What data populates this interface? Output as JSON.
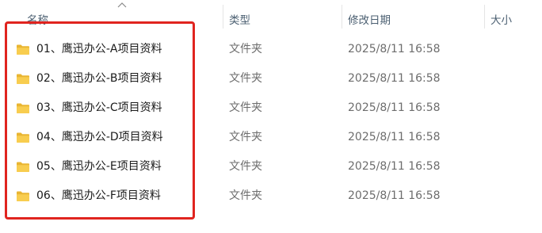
{
  "columns": {
    "name": "名称",
    "type": "类型",
    "date": "修改日期",
    "size": "大小"
  },
  "rows": [
    {
      "name": "01、鹰迅办公-A项目资料",
      "type": "文件夹",
      "date": "2025/8/11 16:58",
      "icon": "folder-icon"
    },
    {
      "name": "02、鹰迅办公-B项目资料",
      "type": "文件夹",
      "date": "2025/8/11 16:58",
      "icon": "folder-icon"
    },
    {
      "name": "03、鹰迅办公-C项目资料",
      "type": "文件夹",
      "date": "2025/8/11 16:58",
      "icon": "folder-icon"
    },
    {
      "name": "04、鹰迅办公-D项目资料",
      "type": "文件夹",
      "date": "2025/8/11 16:58",
      "icon": "folder-icon"
    },
    {
      "name": "05、鹰迅办公-E项目资料",
      "type": "文件夹",
      "date": "2025/8/11 16:58",
      "icon": "folder-icon"
    },
    {
      "name": "06、鹰迅办公-F项目资料",
      "type": "文件夹",
      "date": "2025/8/11 16:58",
      "icon": "folder-icon"
    }
  ],
  "colors": {
    "highlight_border": "#e0241f",
    "folder": "#f5c542"
  }
}
